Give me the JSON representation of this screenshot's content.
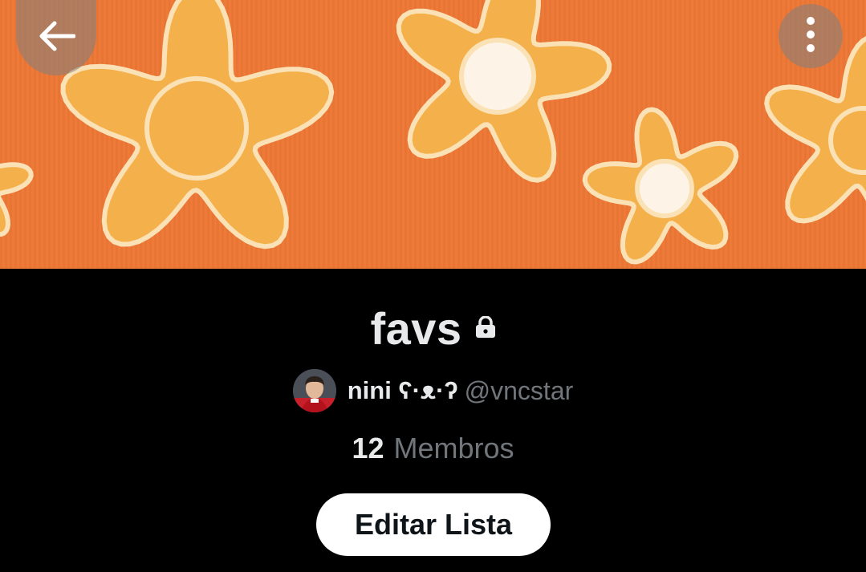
{
  "colors": {
    "banner_orange": "#ef7a38",
    "flower_yellow": "#f4b14b",
    "flower_outline": "#fbe2b6",
    "background": "#000000",
    "primary_text": "#e7e9ea",
    "secondary_text": "#71767b",
    "button_bg": "#ffffff"
  },
  "header": {
    "back_icon": "arrow-left-icon",
    "more_icon": "vertical-ellipsis-icon"
  },
  "list": {
    "title": "favs",
    "lock_icon": "lock-icon",
    "owner": {
      "display_name": "nini ʕ·ᴥ·ʔ",
      "handle": "@vncstar"
    },
    "members_count": "12",
    "members_label": "Membros",
    "edit_button_label": "Editar Lista"
  }
}
